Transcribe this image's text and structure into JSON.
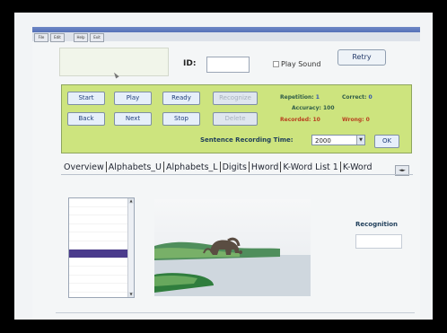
{
  "menu": [
    "File",
    "Edit",
    "Help",
    "Exit"
  ],
  "id_label": "ID:",
  "id_value": "",
  "play_sound_label": "Play Sound",
  "retry_label": "Retry",
  "buttons": {
    "start": "Start",
    "play": "Play",
    "ready": "Ready",
    "recognize": "Recognize",
    "back": "Back",
    "next": "Next",
    "stop": "Stop",
    "delete": "Delete"
  },
  "stats": {
    "repetition_label": "Repetition:",
    "repetition_value": "1",
    "accuracy_label": "Accuracy:",
    "accuracy_value": "100",
    "recorded_label": "Recorded:",
    "recorded_value": "10",
    "correct_label": "Correct:",
    "correct_value": "0",
    "wrong_label": "Wrong:",
    "wrong_value": "0"
  },
  "sentence_recording_time_label": "Sentence Recording Time:",
  "sentence_recording_time_value": "2000",
  "ok_label": "OK",
  "tabs": [
    "Overview",
    "Alphabets_U",
    "Alphabets_L",
    "Digits",
    "Hword",
    "K-Word List 1",
    "K-Word"
  ],
  "list_items": [
    "",
    "",
    "",
    "",
    "",
    "",
    "",
    "",
    "",
    "",
    "",
    "",
    "",
    ""
  ],
  "recognition_label": "Recognition",
  "recognition_value": ""
}
